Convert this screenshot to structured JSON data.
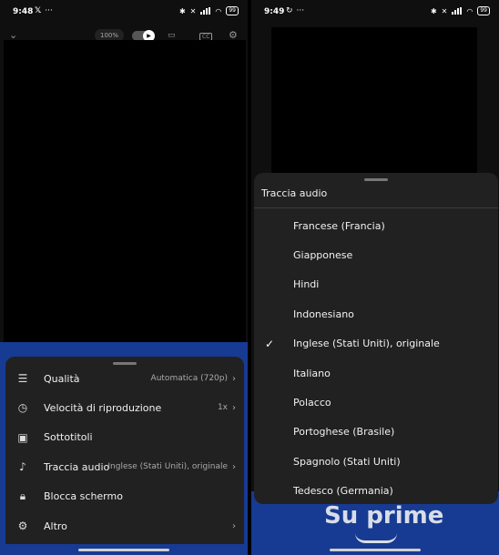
{
  "left": {
    "status": {
      "time": "9:48",
      "battery": "99",
      "icons_left": [
        "x-logo-icon",
        "more-dots-icon"
      ]
    },
    "player": {
      "zoom": "100%"
    },
    "menu": [
      {
        "name": "quality",
        "icon": "sliders-icon",
        "label": "Qualità",
        "value": "Automatica (720p)",
        "chevron": "›"
      },
      {
        "name": "speed",
        "icon": "playback-speed-icon",
        "label": "Velocità di riproduzione",
        "value": "1x",
        "chevron": "›"
      },
      {
        "name": "subtitles",
        "icon": "cc-icon",
        "label": "Sottotitoli",
        "value": "",
        "chevron": ""
      },
      {
        "name": "audio-track",
        "icon": "audio-track-icon",
        "label": "Traccia audio",
        "value": "Inglese (Stati Uniti), originale",
        "chevron": "›"
      },
      {
        "name": "lock-screen",
        "icon": "lock-icon",
        "label": "Blocca schermo",
        "value": "",
        "chevron": ""
      },
      {
        "name": "more",
        "icon": "gear-icon",
        "label": "Altro",
        "value": "",
        "chevron": "›"
      }
    ]
  },
  "right": {
    "status": {
      "time": "9:49",
      "battery": "99"
    },
    "sheet": {
      "title": "Traccia audio",
      "options": [
        {
          "label": "Francese (Francia)",
          "selected": false
        },
        {
          "label": "Giapponese",
          "selected": false
        },
        {
          "label": "Hindi",
          "selected": false
        },
        {
          "label": "Indonesiano",
          "selected": false
        },
        {
          "label": "Inglese (Stati Uniti), originale",
          "selected": true
        },
        {
          "label": "Italiano",
          "selected": false
        },
        {
          "label": "Polacco",
          "selected": false
        },
        {
          "label": "Portoghese (Brasile)",
          "selected": false
        },
        {
          "label": "Spagnolo (Stati Uniti)",
          "selected": false
        },
        {
          "label": "Tedesco (Germania)",
          "selected": false
        }
      ]
    },
    "brand": "Su prime"
  },
  "colors": {
    "sheet": "#212121",
    "background_blue": "#173b93",
    "screen_dark": "#0f0f0f"
  }
}
